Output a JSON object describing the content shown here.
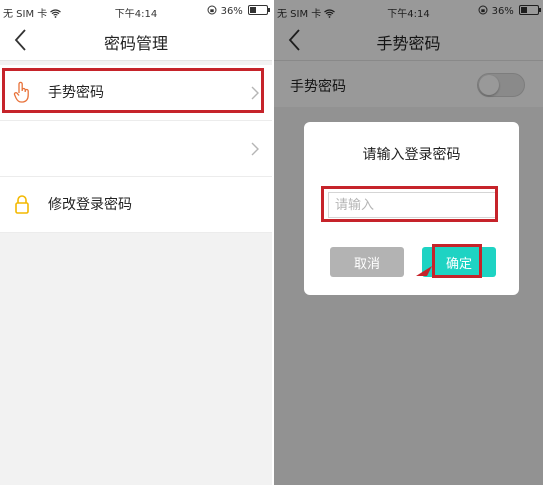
{
  "status_bar": {
    "carrier": "无 SIM 卡",
    "time": "下午4:14",
    "battery": "36%"
  },
  "left_screen": {
    "title": "密码管理",
    "rows": [
      {
        "label": "手势密码",
        "icon": "hand-pointer-icon"
      },
      {
        "label": ""
      },
      {
        "label": "修改登录密码",
        "icon": "lock-icon"
      }
    ]
  },
  "right_screen": {
    "title": "手势密码",
    "switch_label": "手势密码",
    "switch_on": false,
    "dialog": {
      "title": "请输入登录密码",
      "input_placeholder": "请输入",
      "cancel_label": "取消",
      "confirm_label": "确定"
    }
  },
  "colors": {
    "highlight": "#c6232a",
    "confirm": "#1ed3c3",
    "cancel": "#b3b3b3",
    "icon_yellow": "#f3b800"
  }
}
